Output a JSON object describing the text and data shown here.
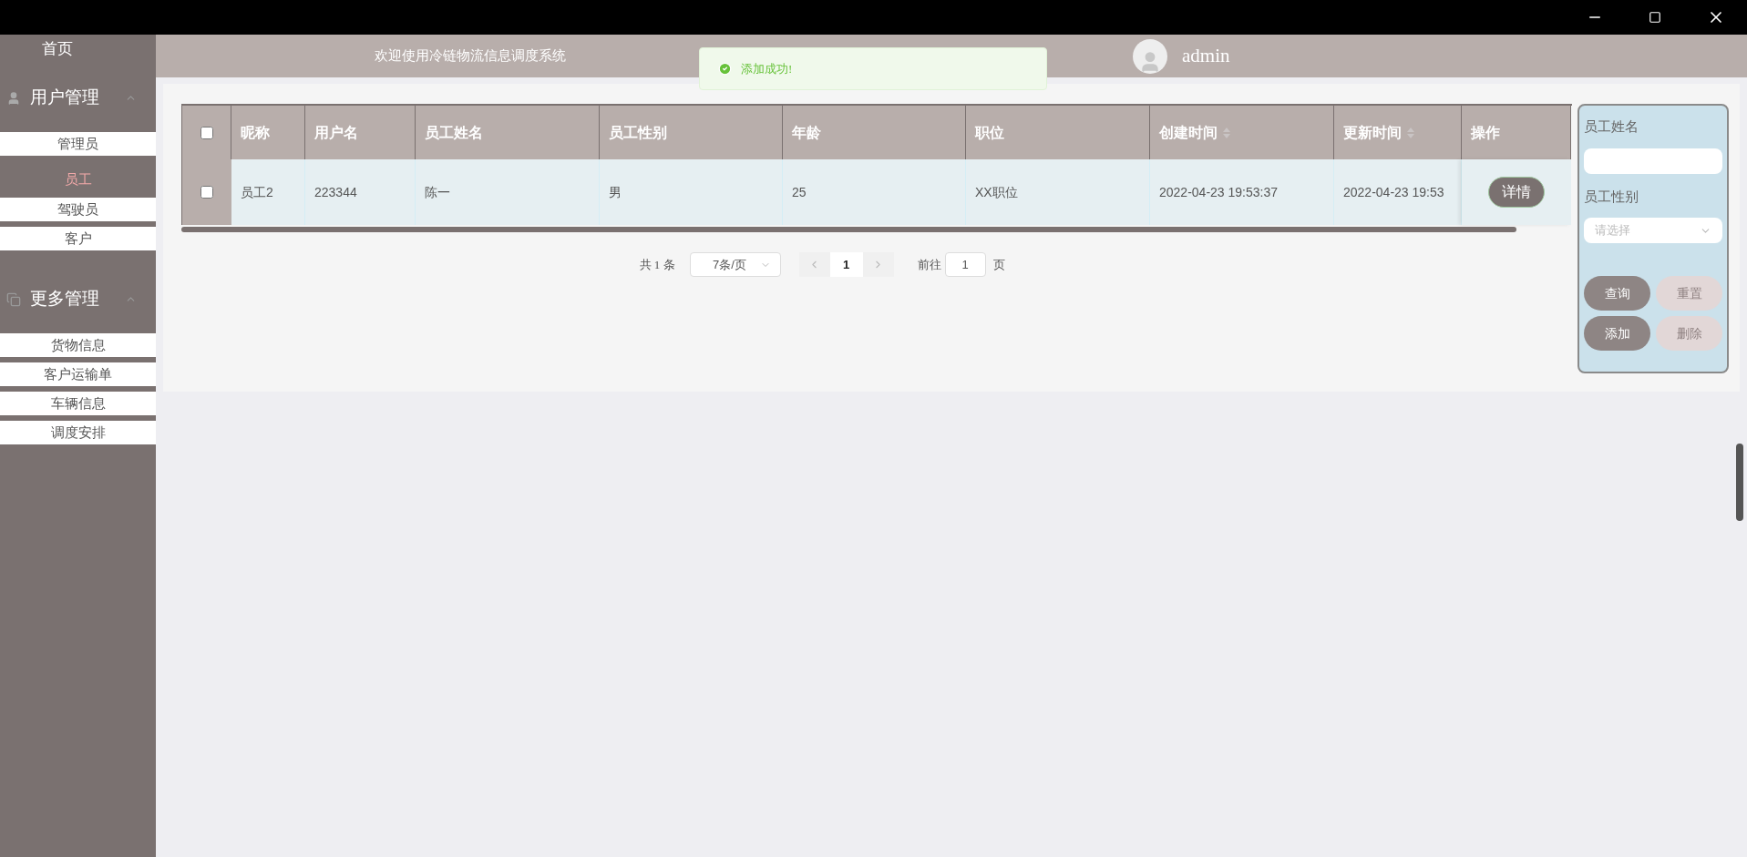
{
  "sidebar": {
    "home": "首页",
    "groups": [
      {
        "kind": "user",
        "label": "用户管理",
        "expanded": true,
        "items": [
          {
            "label": "管理员",
            "selected": false
          },
          {
            "label": "员工",
            "selected": true
          },
          {
            "label": "驾驶员",
            "selected": false
          },
          {
            "label": "客户",
            "selected": false
          }
        ]
      },
      {
        "kind": "more",
        "label": "更多管理",
        "expanded": true,
        "items": [
          {
            "label": "货物信息",
            "selected": false
          },
          {
            "label": "客户运输单",
            "selected": false
          },
          {
            "label": "车辆信息",
            "selected": false
          },
          {
            "label": "调度安排",
            "selected": false
          }
        ]
      }
    ]
  },
  "header": {
    "title": "欢迎使用冷链物流信息调度系统",
    "user": "admin"
  },
  "toast": {
    "kind": "success",
    "text": "添加成功!"
  },
  "table": {
    "select_all": {
      "checked": false
    },
    "columns": [
      {
        "label": "昵称",
        "sortable": false
      },
      {
        "label": "用户名",
        "sortable": false
      },
      {
        "label": "员工姓名",
        "sortable": false
      },
      {
        "label": "员工性别",
        "sortable": false
      },
      {
        "label": "年龄",
        "sortable": false
      },
      {
        "label": "职位",
        "sortable": false
      },
      {
        "label": "创建时间",
        "sortable": true
      },
      {
        "label": "更新时间",
        "sortable": true
      },
      {
        "label": "操作",
        "sortable": false
      }
    ],
    "rows": [
      {
        "checked": false,
        "cells": [
          "员工2",
          "223344",
          "陈一",
          "男",
          "25",
          "XX职位",
          "2022-04-23 19:53:37",
          "2022-04-23 19:53"
        ],
        "action": "详情"
      }
    ]
  },
  "pagination": {
    "total": "共 1 条",
    "page_size": "7条/页",
    "pages": [
      {
        "label": "1",
        "selected": true
      }
    ],
    "goto_label": "前往",
    "goto_value": "1",
    "goto_suffix": "页"
  },
  "filter": {
    "fields": [
      {
        "kind": "text",
        "label": "员工姓名"
      },
      {
        "kind": "select",
        "label": "员工性别",
        "placeholder": "请选择"
      }
    ],
    "buttons": [
      {
        "label": "查询",
        "disabled": false
      },
      {
        "label": "重置",
        "disabled": true
      },
      {
        "label": "添加",
        "disabled": false
      },
      {
        "label": "删除",
        "disabled": true
      }
    ]
  }
}
